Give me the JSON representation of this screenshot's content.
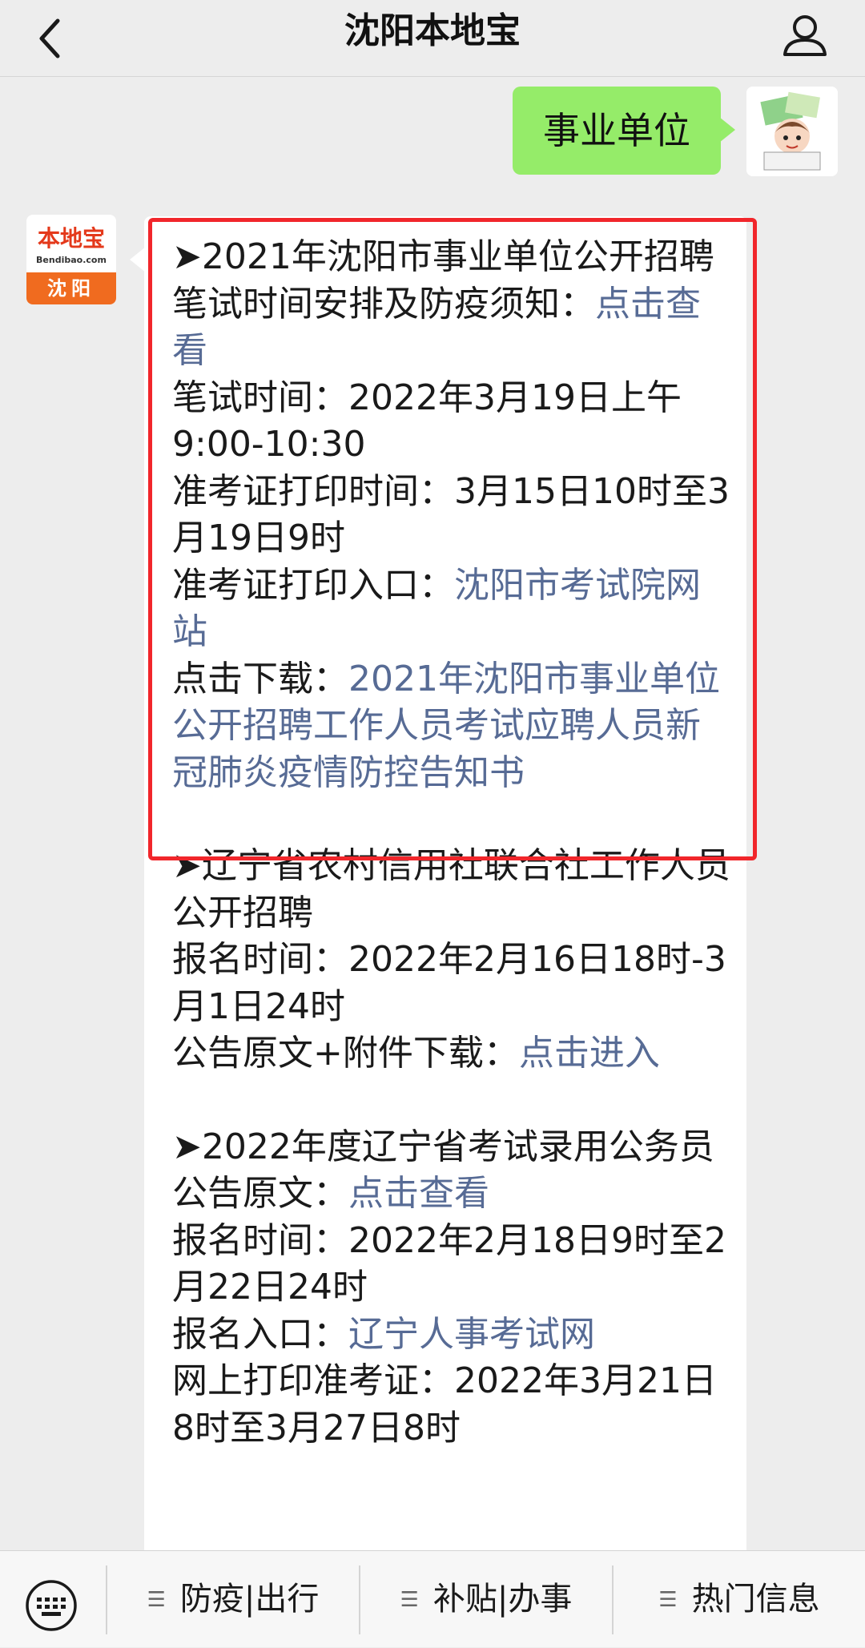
{
  "header": {
    "title": "沈阳本地宝"
  },
  "user_message": {
    "text": "事业单位"
  },
  "bot": {
    "brand": "本地宝",
    "brand_sub": "Bendibao.com",
    "city": "沈阳"
  },
  "sections": [
    {
      "lines": [
        {
          "text": "➤2021年沈阳市事业单位公开招聘"
        },
        {
          "text": "笔试时间安排及防疫须知：",
          "link": "点击查看"
        },
        {
          "text": "笔试时间：2022年3月19日上午9:00-10:30"
        },
        {
          "text": "准考证打印时间：3月15日10时至3月19日9时"
        },
        {
          "text": "准考证打印入口：",
          "link": "沈阳市考试院网站"
        },
        {
          "text": "点击下载：",
          "link": "2021年沈阳市事业单位公开招聘工作人员考试应聘人员新冠肺炎疫情防控告知书"
        }
      ]
    },
    {
      "lines": [
        {
          "text": "➤辽宁省农村信用社联合社工作人员公开招聘"
        },
        {
          "text": "报名时间：2022年2月16日18时-3月1日24时"
        },
        {
          "text": "公告原文+附件下载：",
          "link": "点击进入"
        }
      ]
    },
    {
      "lines": [
        {
          "text": "➤2022年度辽宁省考试录用公务员"
        },
        {
          "text": "公告原文：",
          "link": "点击查看"
        },
        {
          "text": "报名时间：2022年2月18日9时至2月22日24时"
        },
        {
          "text": "报名入口：",
          "link": "辽宁人事考试网"
        },
        {
          "text": "网上打印准考证：2022年3月21日8时至3月27日8时"
        }
      ]
    }
  ],
  "bottom_nav": {
    "items": [
      {
        "label": "防疫|出行"
      },
      {
        "label": "补贴|办事"
      },
      {
        "label": "热门信息"
      }
    ]
  },
  "colors": {
    "link": "#576b95",
    "user_bubble": "#95ec69",
    "highlight_border": "#f1262b",
    "brand_orange": "#f06b1f"
  },
  "icons": [
    "back-arrow-icon",
    "profile-icon",
    "keyboard-icon",
    "menu-icon"
  ]
}
